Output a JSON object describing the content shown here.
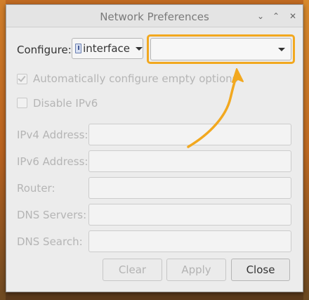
{
  "window": {
    "title": "Network Preferences",
    "controls": {
      "minimize": "⌄",
      "maximize": "⌃",
      "close": "✕"
    }
  },
  "configure": {
    "label": "Configure:",
    "type_value": "interface",
    "target_value": ""
  },
  "options": {
    "auto_configure": {
      "label": "Automatically configure empty options",
      "checked": true,
      "enabled": false
    },
    "disable_ipv6": {
      "label": "Disable IPv6",
      "checked": false,
      "enabled": false
    }
  },
  "fields": [
    {
      "label": "IPv4 Address:",
      "value": ""
    },
    {
      "label": "IPv6 Address:",
      "value": ""
    },
    {
      "label": "Router:",
      "value": ""
    },
    {
      "label": "DNS Servers:",
      "value": ""
    },
    {
      "label": "DNS Search:",
      "value": ""
    }
  ],
  "buttons": {
    "clear": "Clear",
    "apply": "Apply",
    "close": "Close"
  },
  "colors": {
    "highlight": "#f2a81f",
    "arrow": "#f2a81f",
    "disabled_text": "#b5b5b5"
  },
  "icons": {
    "interface": "network-interface-icon",
    "dropdown": "chevron-down-icon"
  }
}
